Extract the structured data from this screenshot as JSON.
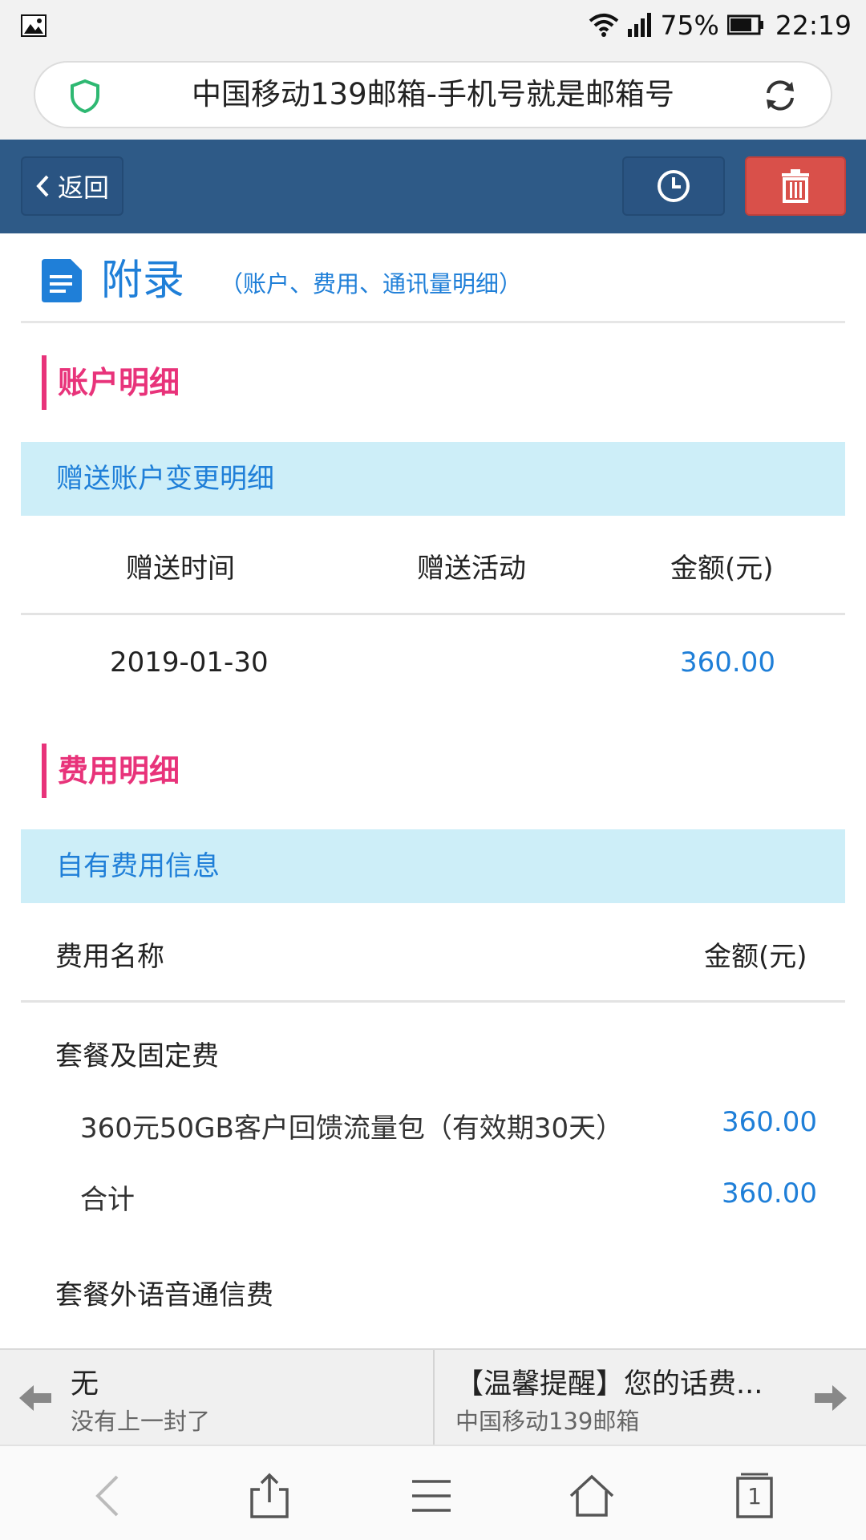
{
  "status_bar": {
    "battery_percent": "75%",
    "time": "22:19",
    "icons": [
      "image-icon",
      "wifi-icon",
      "signal-icon",
      "battery-icon"
    ]
  },
  "address_bar": {
    "title": "中国移动139邮箱-手机号就是邮箱号",
    "icons": [
      "shield-icon",
      "reload-icon"
    ]
  },
  "toolbar": {
    "back_label": "返回",
    "icons": [
      "chevron-left-icon",
      "clock-icon",
      "trash-icon"
    ],
    "colors": {
      "bar": "#2e5a87",
      "delete": "#d9504a"
    }
  },
  "appendix": {
    "title": "附录",
    "subtitle": "（账户、费用、通讯量明细）"
  },
  "account_section": {
    "title": "账户明细",
    "band": "赠送账户变更明细",
    "columns": [
      "赠送时间",
      "赠送活动",
      "金额(元)"
    ],
    "rows": [
      {
        "date": "2019-01-30",
        "activity": "",
        "amount": "360.00"
      }
    ]
  },
  "fee_section": {
    "title": "费用明细",
    "band": "自有费用信息",
    "columns": [
      "费用名称",
      "金额(元)"
    ],
    "group1": {
      "name": "套餐及固定费",
      "items": [
        {
          "name": "360元50GB客户回馈流量包（有效期30天）",
          "amount": "360.00"
        },
        {
          "name": "合计",
          "amount": "360.00"
        }
      ]
    },
    "group2": {
      "name": "套餐外语音通信费"
    }
  },
  "mail_nav": {
    "prev_title": "无",
    "prev_sub": "没有上一封了",
    "next_title": "【温馨提醒】您的话费...",
    "next_sub": "中国移动139邮箱"
  },
  "browser_bar": {
    "tab_count": "1",
    "icons": [
      "back-icon",
      "share-icon",
      "menu-icon",
      "home-icon",
      "tabs-icon"
    ]
  }
}
